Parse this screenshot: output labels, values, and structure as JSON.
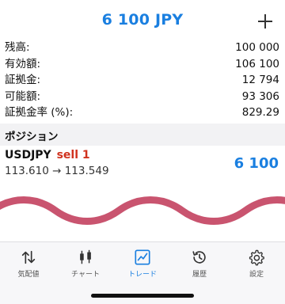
{
  "header": {
    "title": "6 100 JPY"
  },
  "summary": [
    {
      "label": "残高:",
      "value": "100 000"
    },
    {
      "label": "有効額:",
      "value": "106 100"
    },
    {
      "label": "証拠金:",
      "value": "12 794"
    },
    {
      "label": "可能額:",
      "value": "93 306"
    },
    {
      "label": "証拠金率 (%):",
      "value": "829.29"
    }
  ],
  "positions_section": {
    "title": "ポジション"
  },
  "position": {
    "symbol": "USDJPY",
    "side": "sell 1",
    "prices": "113.610 → 113.549",
    "profit": "6 100"
  },
  "tabs": [
    {
      "label": "気配値",
      "icon": "arrows-up-down-icon",
      "active": false
    },
    {
      "label": "チャート",
      "icon": "candlestick-icon",
      "active": false
    },
    {
      "label": "トレード",
      "icon": "trade-chart-icon",
      "active": true
    },
    {
      "label": "履歴",
      "icon": "history-clock-icon",
      "active": false
    },
    {
      "label": "設定",
      "icon": "gear-icon",
      "active": false
    }
  ],
  "colors": {
    "accent": "#1a7fe0",
    "sell": "#d0321e",
    "wave": "#c9546f"
  }
}
